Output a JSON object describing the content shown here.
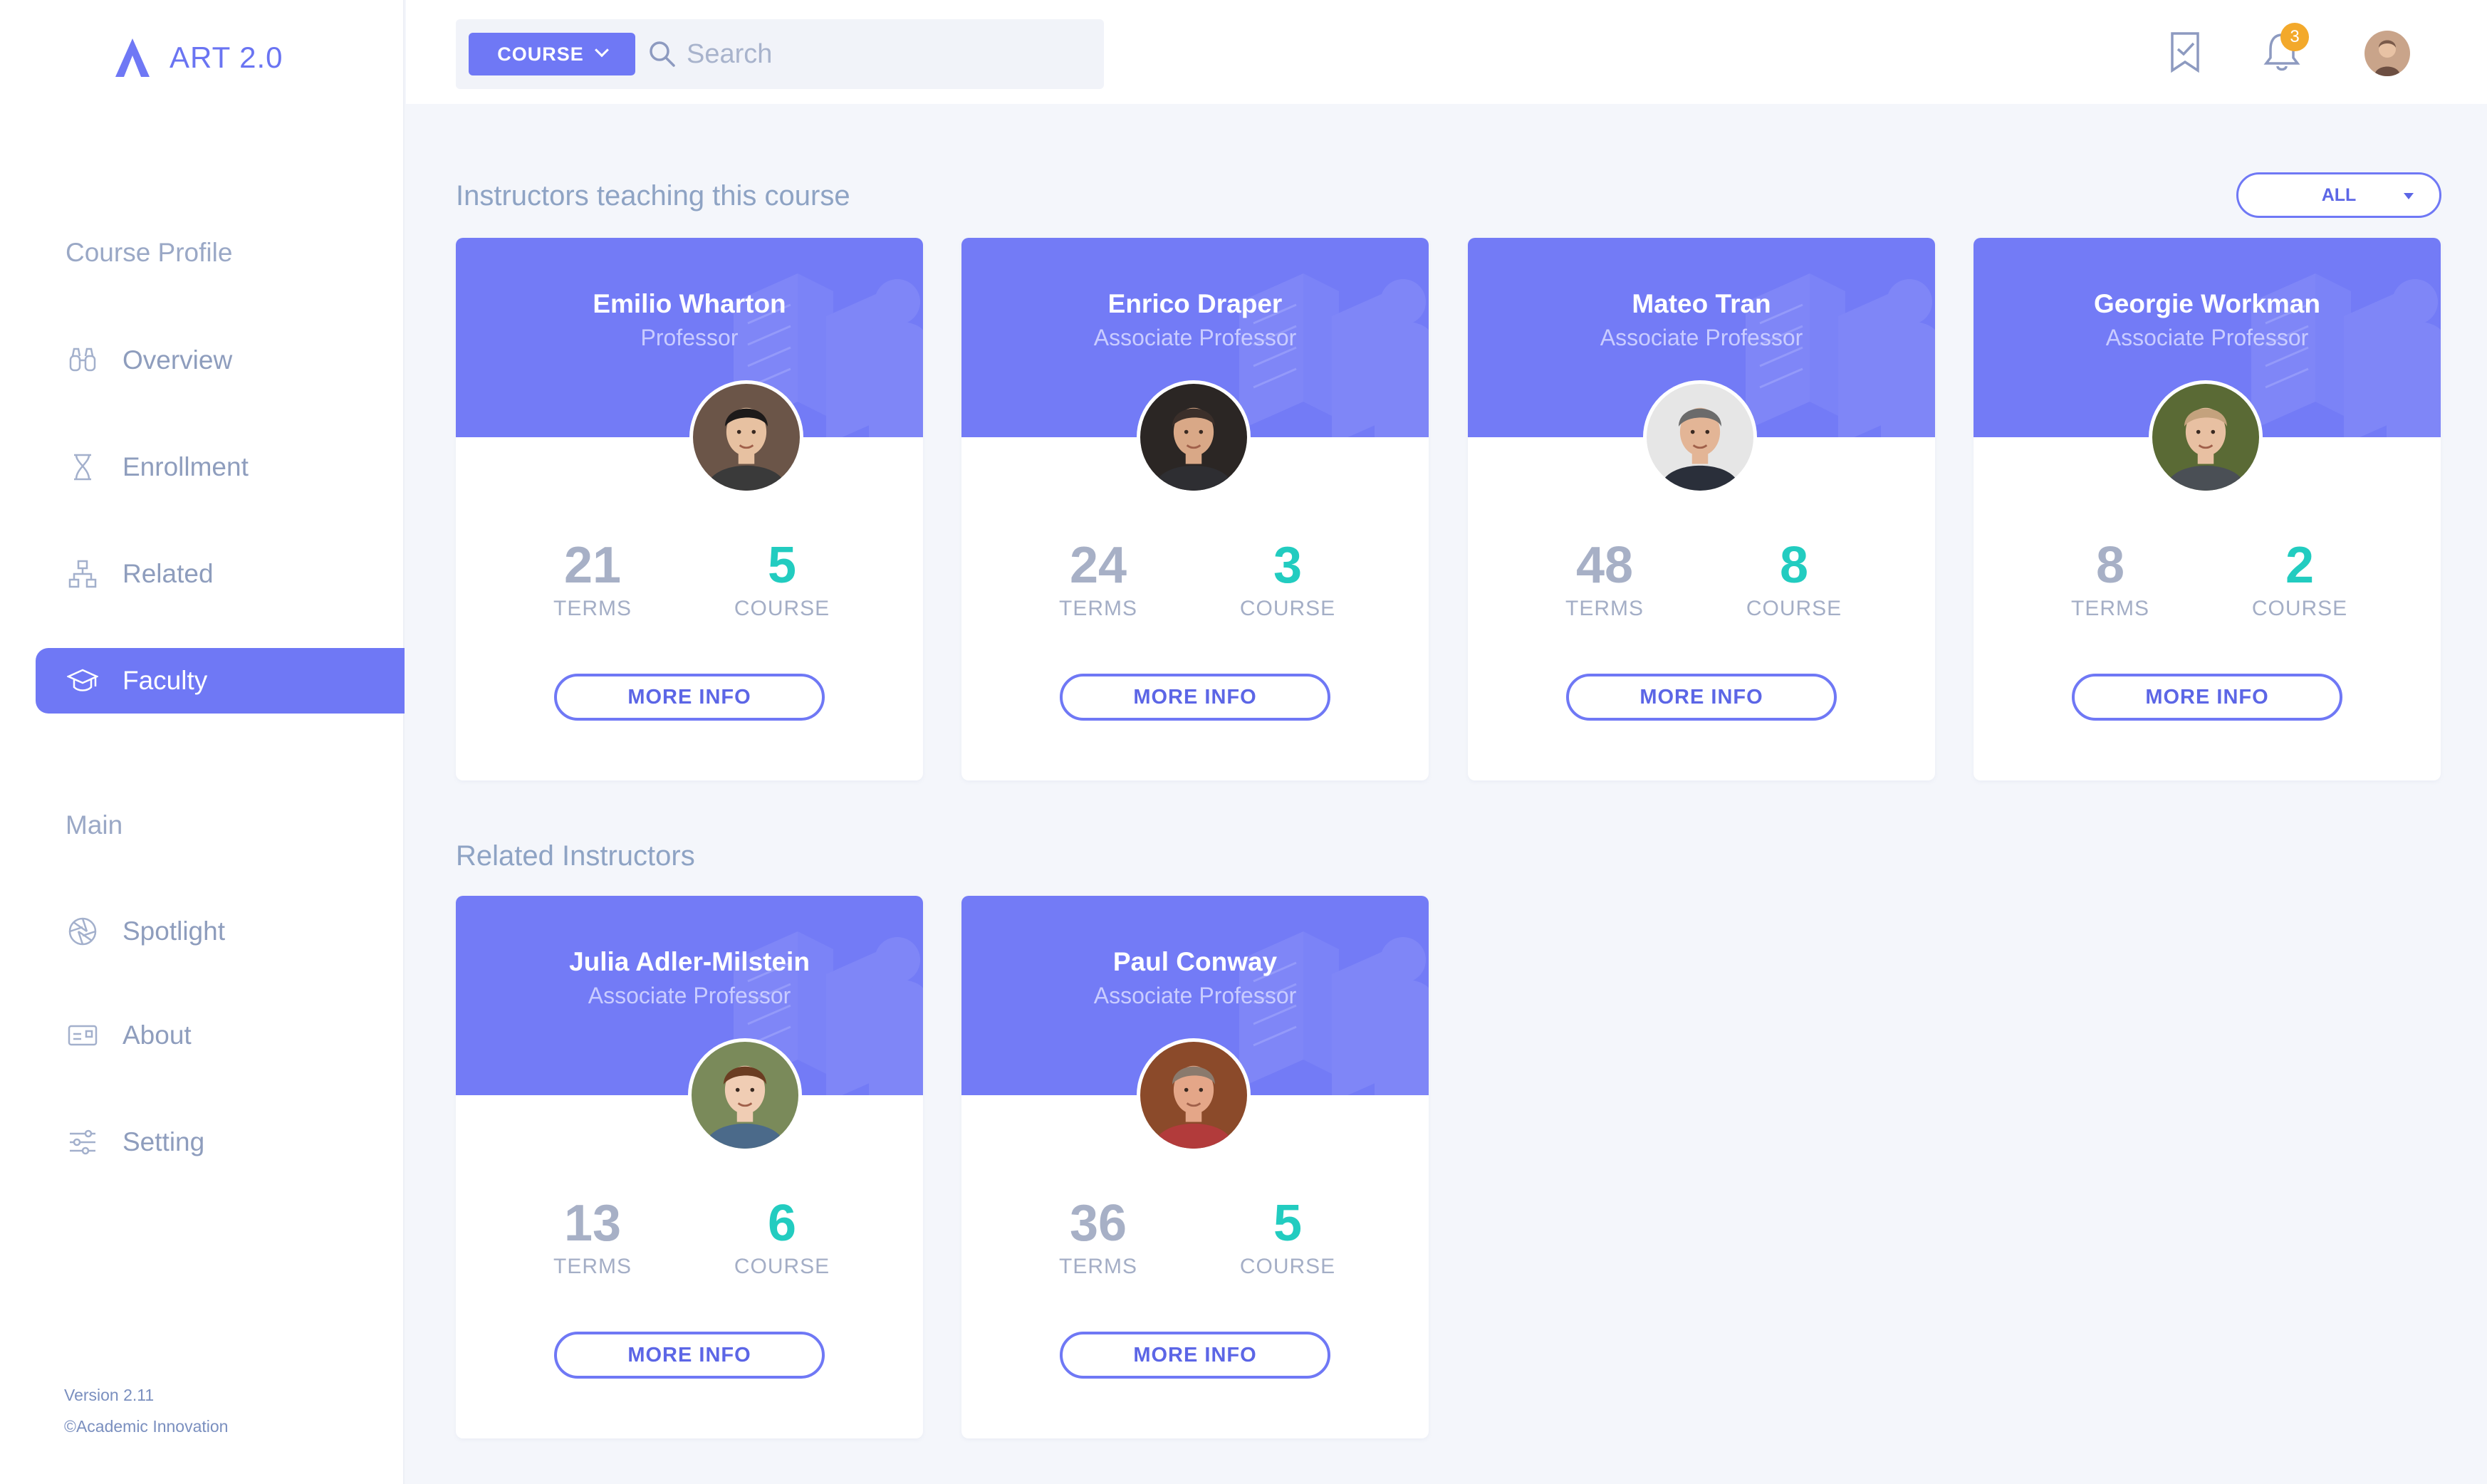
{
  "app": {
    "title": "ART 2.0"
  },
  "sidebar": {
    "section1_label": "Course Profile",
    "section2_label": "Main",
    "items": [
      {
        "label": "Overview",
        "icon": "binoculars-icon"
      },
      {
        "label": "Enrollment",
        "icon": "hourglass-icon"
      },
      {
        "label": "Related",
        "icon": "sitemap-icon"
      },
      {
        "label": "Faculty",
        "icon": "graduation-cap-icon",
        "active": true
      },
      {
        "label": "Spotlight",
        "icon": "aperture-icon"
      },
      {
        "label": "About",
        "icon": "id-card-icon"
      },
      {
        "label": "Setting",
        "icon": "sliders-icon"
      }
    ],
    "version": "Version 2.11",
    "copyright": "©Academic Innovation"
  },
  "topbar": {
    "course_button": "COURSE",
    "search_placeholder": "Search",
    "notification_count": "3"
  },
  "main": {
    "instructors_title": "Instructors teaching this course",
    "related_title": "Related Instructors",
    "filter_value": "ALL",
    "terms_label": "TERMS",
    "course_label": "COURSE",
    "more_info_label": "MORE INFO"
  },
  "instructors": [
    {
      "name": "Emilio Wharton",
      "role": "Professor",
      "terms": "21",
      "courses": "5"
    },
    {
      "name": "Enrico Draper",
      "role": "Associate Professor",
      "terms": "24",
      "courses": "3"
    },
    {
      "name": "Mateo Tran",
      "role": "Associate Professor",
      "terms": "48",
      "courses": "8"
    },
    {
      "name": "Georgie Workman",
      "role": "Associate Professor",
      "terms": "8",
      "courses": "2"
    }
  ],
  "related": [
    {
      "name": "Julia Adler-Milstein",
      "role": "Associate Professor",
      "terms": "13",
      "courses": "6"
    },
    {
      "name": "Paul Conway",
      "role": "Associate Professor",
      "terms": "36",
      "courses": "5"
    }
  ],
  "colors": {
    "accent": "#6f78f5",
    "teal": "#22ccc0",
    "badge": "#f3a92b"
  }
}
